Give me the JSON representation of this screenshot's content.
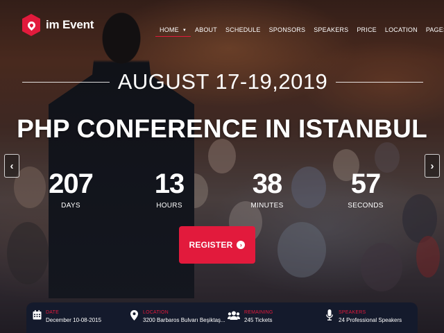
{
  "logo": {
    "text": "im Event",
    "icon": "map-pin-icon"
  },
  "nav": {
    "items": [
      {
        "label": "HOME",
        "has_dropdown": true,
        "active": true
      },
      {
        "label": "ABOUT",
        "has_dropdown": false
      },
      {
        "label": "SCHEDULE",
        "has_dropdown": false
      },
      {
        "label": "SPONSORS",
        "has_dropdown": false
      },
      {
        "label": "SPEAKERS",
        "has_dropdown": false
      },
      {
        "label": "PRICE",
        "has_dropdown": false
      },
      {
        "label": "LOCATION",
        "has_dropdown": false
      },
      {
        "label": "PAGES",
        "has_dropdown": true
      }
    ]
  },
  "hero": {
    "date": "AUGUST 17-19,2019",
    "title": "PHP CONFERENCE IN ISTANBUL",
    "prev_icon": "chevron-left-icon",
    "next_icon": "chevron-right-icon"
  },
  "countdown": {
    "days": {
      "value": "207",
      "label": "DAYS"
    },
    "hours": {
      "value": "13",
      "label": "HOURS"
    },
    "minutes": {
      "value": "38",
      "label": "MINUTES"
    },
    "seconds": {
      "value": "57",
      "label": "SECONDS"
    }
  },
  "register": {
    "label": "REGISTER",
    "icon": "arrow-right-circle-icon"
  },
  "info": {
    "date": {
      "label": "DATE",
      "value": "December 10-08-2015",
      "icon": "calendar-icon"
    },
    "location": {
      "label": "LOCATION",
      "value": "3200 Barbaros Bulvarı Beşiktaş...",
      "icon": "map-marker-icon"
    },
    "remaining": {
      "label": "REMAINING",
      "value": "245 Tickets",
      "icon": "users-icon"
    },
    "speakers": {
      "label": "SPEAKERS",
      "value": "24 Professional Speakers",
      "icon": "microphone-icon"
    }
  },
  "colors": {
    "accent": "#e21a3c",
    "bar": "#141a2c"
  }
}
